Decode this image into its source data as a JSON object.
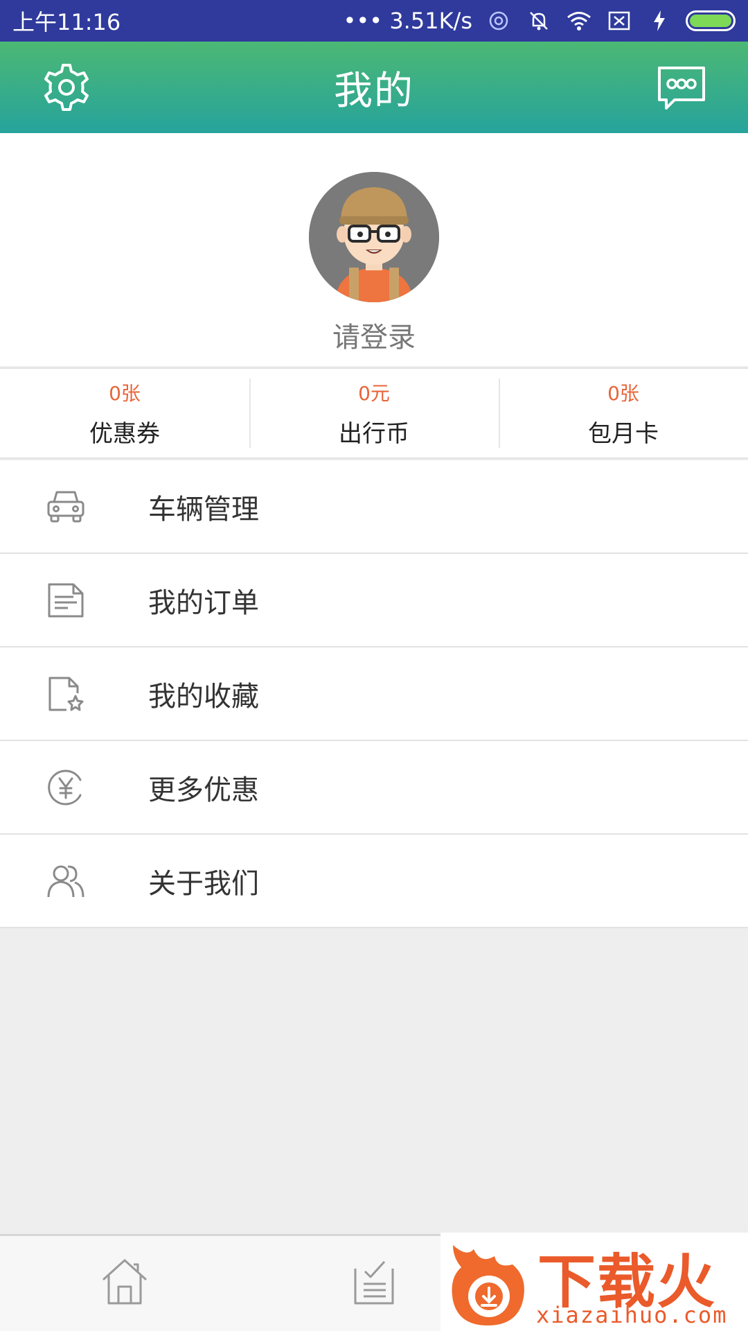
{
  "status_bar": {
    "time": "上午11:16",
    "network_speed": "••• 3.51K/s",
    "icons": [
      "hotspot-icon",
      "mute-icon",
      "wifi-icon",
      "sim-icon",
      "charging-icon",
      "battery-icon"
    ]
  },
  "header": {
    "title": "我的",
    "settings_icon": "gear-icon",
    "messages_icon": "message-icon"
  },
  "profile": {
    "login_text": "请登录"
  },
  "stats": [
    {
      "value": "0张",
      "label": "优惠券"
    },
    {
      "value": "0元",
      "label": "出行币"
    },
    {
      "value": "0张",
      "label": "包月卡"
    }
  ],
  "menu": [
    {
      "label": "车辆管理",
      "icon": "car-icon"
    },
    {
      "label": "我的订单",
      "icon": "order-icon"
    },
    {
      "label": "我的收藏",
      "icon": "favorite-icon"
    },
    {
      "label": "更多优惠",
      "icon": "yen-icon"
    },
    {
      "label": "关于我们",
      "icon": "users-icon"
    }
  ],
  "bottom_nav": {
    "items": [
      {
        "icon": "home-icon"
      },
      {
        "icon": "orders-icon"
      }
    ]
  },
  "watermark": {
    "text": "下载火",
    "url": "xiazaihuo.com"
  },
  "colors": {
    "status_bar": "#2f3a9c",
    "header_top": "#4cb874",
    "header_bottom": "#26a39c",
    "accent_value": "#e8643a"
  }
}
